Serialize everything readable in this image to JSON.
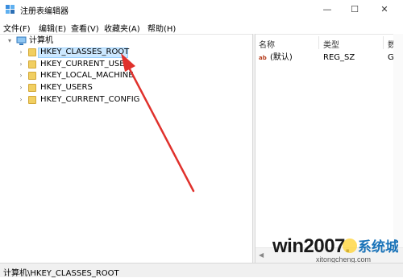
{
  "window": {
    "title": "注册表编辑器",
    "minimize_glyph": "—",
    "maximize_glyph": "☐",
    "close_glyph": "✕"
  },
  "menu": [
    "文件(F)",
    "编辑(E)",
    "查看(V)",
    "收藏夹(A)",
    "帮助(H)"
  ],
  "tree": {
    "root": "计算机",
    "items": [
      "HKEY_CLASSES_ROOT",
      "HKEY_CURRENT_USER",
      "HKEY_LOCAL_MACHINE",
      "HKEY_USERS",
      "HKEY_CURRENT_CONFIG"
    ],
    "selected_index": 0
  },
  "columns": {
    "name": "名称",
    "type": "类型",
    "data": "数据"
  },
  "values": [
    {
      "name": "(默认)",
      "type": "REG_SZ",
      "data": "Gac",
      "icon": "ab-icon"
    }
  ],
  "status_path": "计算机\\HKEY_CLASSES_ROOT",
  "watermark": {
    "text": "win2007.",
    "logo_text": "系统城",
    "sub": "xitongcheng.com"
  },
  "colors": {
    "selection": "#cce8ff",
    "arrow": "#e0312c",
    "folder": "#f1cf61"
  }
}
